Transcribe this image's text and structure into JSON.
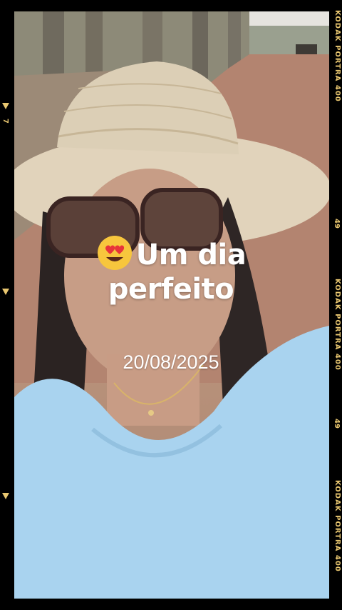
{
  "overlay": {
    "caption_line1": "Um dia",
    "caption_line2": "perfeito",
    "caption_emoji": "smiling-face-with-heart-eyes",
    "date": "20/08/2025"
  },
  "film_frame": {
    "edge_text_1": "KODAK PORTRA 400",
    "edge_num_1": "49",
    "edge_text_2": "KODAK PORTRA 400",
    "edge_num_2": "49",
    "edge_text_3": "KODAK PORTRA 400",
    "left_num": "7",
    "accent_color": "#e9c770"
  },
  "photo": {
    "subject": "selfie-woman-straw-hat-sunglasses",
    "shirt_color": "#a9d3ef",
    "road_color": "#b38470"
  }
}
